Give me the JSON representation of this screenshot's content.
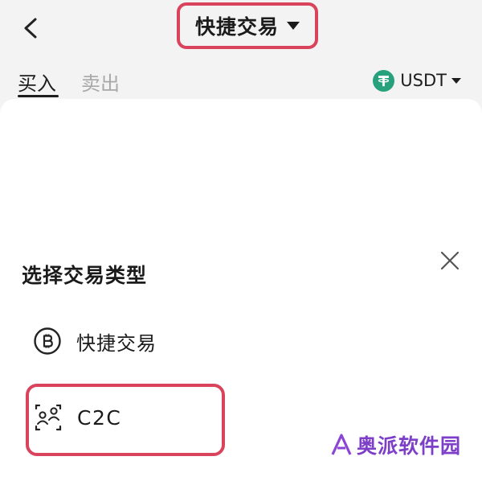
{
  "header": {
    "title": "快捷交易",
    "back_icon": "chevron-left-icon",
    "title_dropdown_icon": "caret-down-icon"
  },
  "tabs": [
    {
      "label": "买入",
      "active": true
    },
    {
      "label": "卖出",
      "active": false
    }
  ],
  "currency": {
    "label": "USDT",
    "icon": "tether-icon",
    "icon_color": "#26a17b"
  },
  "sheet": {
    "title": "选择交易类型",
    "close_icon": "close-icon",
    "options": [
      {
        "label": "快捷交易",
        "icon": "bitcoin-coin-icon"
      },
      {
        "label": "C2C",
        "icon": "users-icon"
      }
    ]
  },
  "watermark": {
    "text": "奥派软件园"
  },
  "colors": {
    "highlight": "#d9435b",
    "tether": "#26a17b",
    "inactive_tab": "#a8a8a8",
    "watermark": "#7d3ec8"
  }
}
